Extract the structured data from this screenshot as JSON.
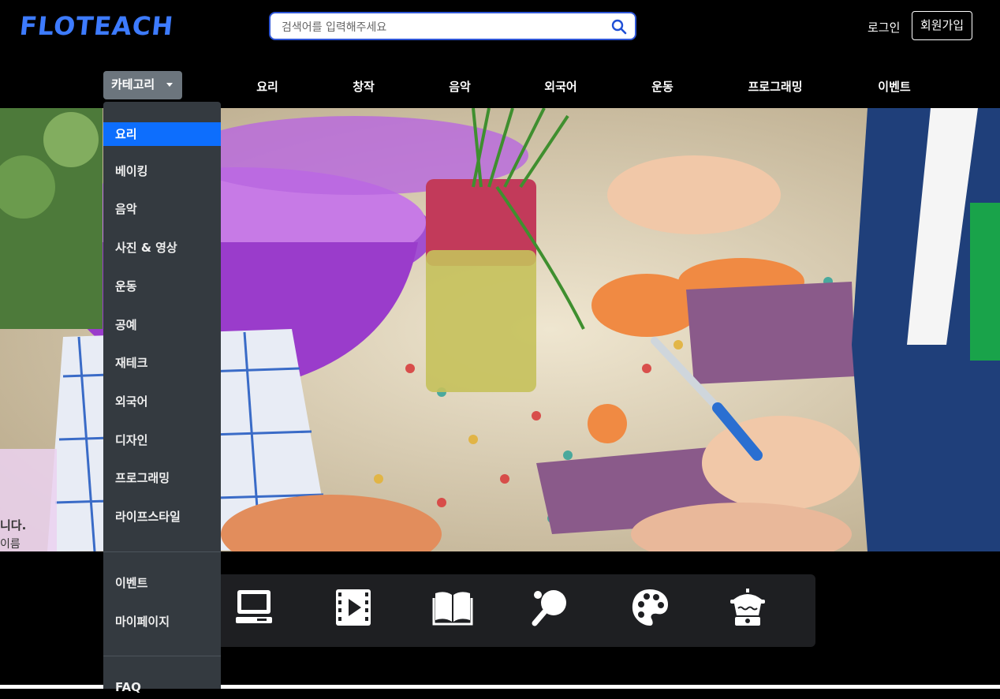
{
  "header": {
    "logo": "FLOTEACH",
    "search_placeholder": "검색어를 입력해주세요",
    "login": "로그인",
    "signup": "회원가입"
  },
  "nav": {
    "category_button": "카테고리",
    "links": [
      "요리",
      "창작",
      "음악",
      "외국어",
      "운동",
      "프로그래밍",
      "이벤트"
    ]
  },
  "dropdown": {
    "items": [
      "요리",
      "베이킹",
      "음악",
      "사진 & 영상",
      "운동",
      "공예",
      "재테크",
      "외국어",
      "디자인",
      "프로그래밍",
      "라이프스타일"
    ],
    "active_index": 0,
    "extra_items": [
      "이벤트",
      "마이페이지"
    ],
    "footer_item": "FAQ"
  },
  "hero": {
    "card_line1": "니다.",
    "card_line2": "이름"
  },
  "iconbar": {
    "icons": [
      "laptop-icon",
      "film-play-icon",
      "open-book-icon",
      "ping-pong-icon",
      "palette-icon",
      "cooking-pot-icon"
    ]
  },
  "colors": {
    "accent": "#0d6efd",
    "logo": "#3d7bff",
    "dropdown_bg": "#343a40",
    "category_button_bg": "#6c757d"
  }
}
